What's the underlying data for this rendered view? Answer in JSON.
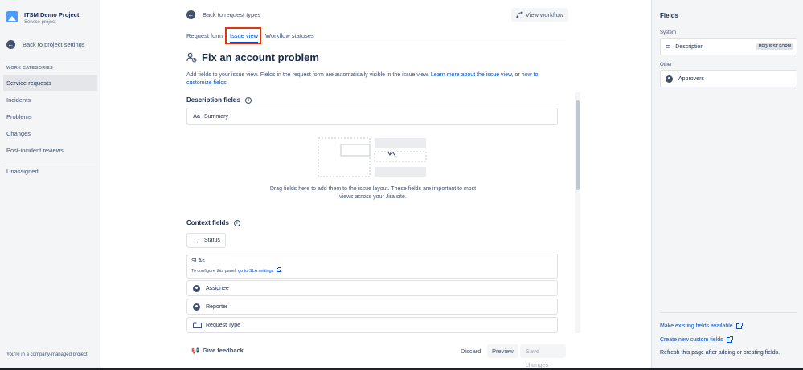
{
  "sidebar": {
    "project_name": "ITSM Demo Project",
    "project_type": "Service project",
    "back_label": "Back to project settings",
    "work_categories_label": "WORK CATEGORIES",
    "items": [
      {
        "label": "Service requests"
      },
      {
        "label": "Incidents"
      },
      {
        "label": "Problems"
      },
      {
        "label": "Changes"
      },
      {
        "label": "Post-incident reviews"
      }
    ],
    "unassigned_label": "Unassigned",
    "footer_text": "You're in a company-managed project"
  },
  "main": {
    "back_label": "Back to request types",
    "view_workflow_label": "View workflow",
    "tabs": [
      {
        "label": "Request form"
      },
      {
        "label": "Issue view"
      },
      {
        "label": "Workflow statuses"
      }
    ],
    "title": "Fix an account problem",
    "description_prefix": "Add fields to your issue view. Fields in the request form are automatically visible in the issue view. ",
    "learn_more_link": "Learn more about the issue view",
    "description_mid": ", or ",
    "customize_link": "how to customize fields",
    "description_suffix": ".",
    "description_fields_title": "Description fields",
    "summary_field": "Summary",
    "drop_text": "Drag fields here to add them to the issue layout. These fields are important to most views across your Jira site.",
    "context_fields_title": "Context fields",
    "status_field": "Status",
    "slas_title": "SLAs",
    "sla_config_prefix": "To configure this panel, ",
    "sla_config_link": "go to SLA settings",
    "sla_config_suffix": ".",
    "context_items": [
      {
        "label": "Assignee"
      },
      {
        "label": "Reporter"
      },
      {
        "label": "Request Type"
      }
    ]
  },
  "footer": {
    "feedback_label": "Give feedback",
    "discard_label": "Discard",
    "preview_label": "Preview",
    "save_label": "Save changes"
  },
  "right_panel": {
    "title": "Fields",
    "system_label": "System",
    "system_field": "Description",
    "system_badge": "REQUEST FORM",
    "other_label": "Other",
    "other_field": "Approvers",
    "make_existing_link": "Make existing fields available",
    "create_new_link": "Create new custom fields",
    "refresh_note": "Refresh this page after adding or creating fields."
  },
  "colors": {
    "accent": "#0052cc",
    "highlight": "#de350b",
    "text": "#172b4d",
    "subtle": "#42526e"
  }
}
